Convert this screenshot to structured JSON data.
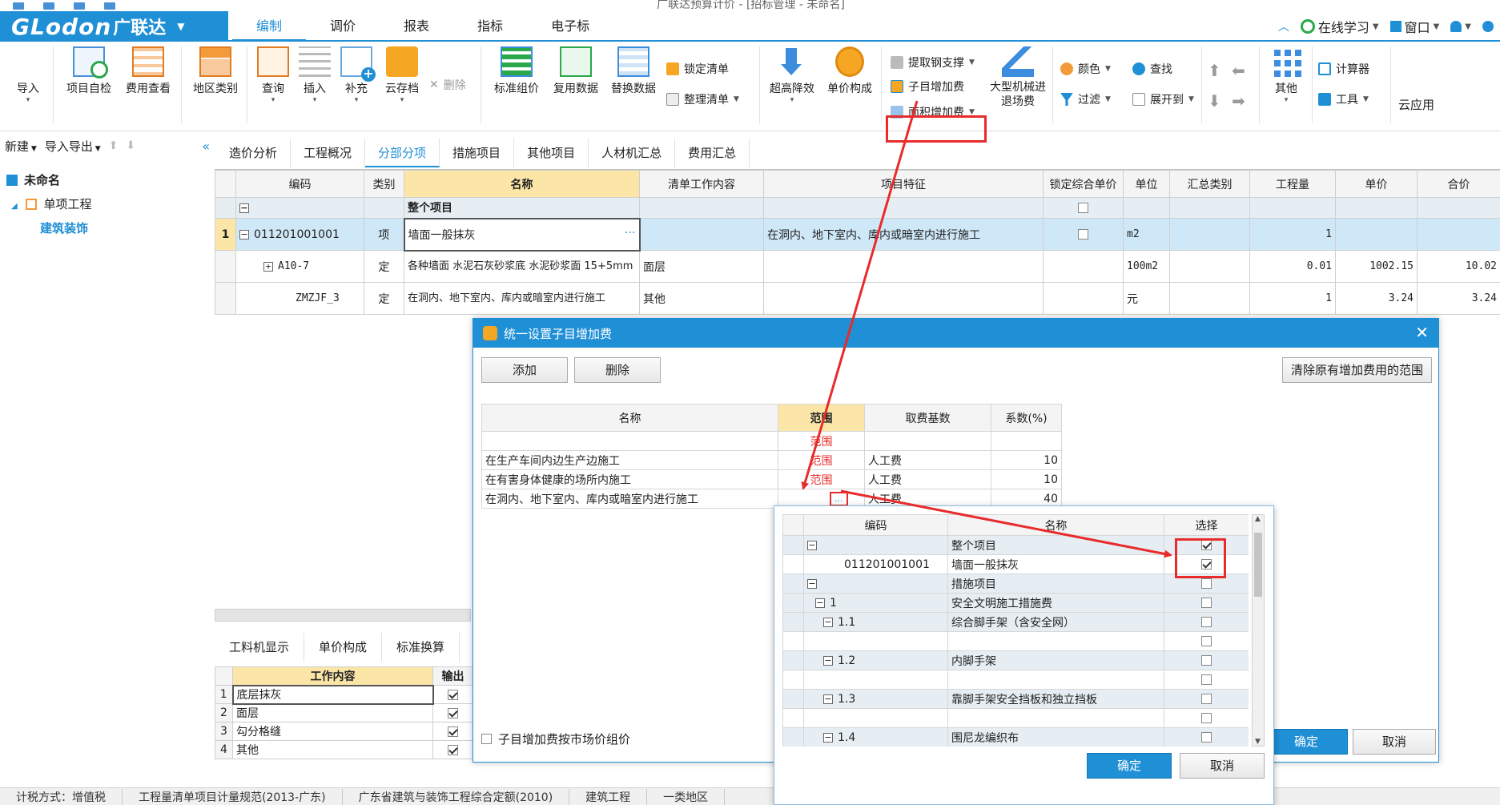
{
  "window": {
    "title": "广联达预算计价 - [招标管理 - 未命名]"
  },
  "brand": {
    "name": "GLodon",
    "cn": "广联达"
  },
  "menu": {
    "tabs": [
      "编制",
      "调价",
      "报表",
      "指标",
      "电子标"
    ],
    "active": 0,
    "online": "在线学习",
    "window": "窗口"
  },
  "ribbon": {
    "import": "导入",
    "self_check": "项目自检",
    "fee_view": "费用查看",
    "region": "地区类别",
    "query": "查询",
    "insert": "插入",
    "supplement": "补充",
    "cloud": "云存档",
    "delete": "删除",
    "std_price": "标准组价",
    "reuse": "复用数据",
    "replace": "替换数据",
    "lock_list": "锁定清单",
    "tidy_list": "整理清单",
    "reduce": "超高降效",
    "unit_comp": "单价构成",
    "steel": "提取钢支撑",
    "sub_add": "子目增加费",
    "area_add": "面积增加费",
    "machine": "大型机械进退场费",
    "color": "颜色",
    "filter": "过滤",
    "find": "查找",
    "expand": "展开到",
    "other": "其他",
    "calculator": "计算器",
    "tools": "工具",
    "cloud_app": "云应用"
  },
  "left": {
    "new": "新建",
    "import_export": "导入导出",
    "tree": [
      "未命名",
      "单项工程",
      "建筑装饰"
    ]
  },
  "subtabs": [
    "造价分析",
    "工程概况",
    "分部分项",
    "措施项目",
    "其他项目",
    "人材机汇总",
    "费用汇总"
  ],
  "subtab_active": 2,
  "grid": {
    "headers": [
      "编码",
      "类别",
      "名称",
      "清单工作内容",
      "项目特征",
      "锁定综合单价",
      "单位",
      "汇总类别",
      "工程量",
      "单价",
      "合价"
    ],
    "group_label": "整个项目",
    "rows": [
      {
        "rn": "1",
        "code": "011201001001",
        "type": "项",
        "name": "墙面一般抹灰",
        "content": "",
        "feature": "在洞内、地下室内、库内或暗室内进行施工",
        "unit": "m2",
        "qty": "1",
        "price": "",
        "total": ""
      },
      {
        "rn": "",
        "code": "A10-7",
        "type": "定",
        "name": "各种墙面 水泥石灰砂浆底 水泥砂浆面 15+5mm",
        "content": "面层",
        "feature": "",
        "unit": "100m2",
        "qty": "0.01",
        "price": "1002.15",
        "total": "10.02"
      },
      {
        "rn": "",
        "code": "ZMZJF_3",
        "type": "定",
        "name": "在洞内、地下室内、库内或暗室内进行施工",
        "content": "其他",
        "feature": "",
        "unit": "元",
        "qty": "1",
        "price": "3.24",
        "total": "3.24"
      }
    ]
  },
  "lower": {
    "tabs": [
      "工料机显示",
      "单价构成",
      "标准换算"
    ],
    "headers": [
      "工作内容",
      "输出"
    ],
    "rows": [
      {
        "rn": "1",
        "name": "底层抹灰"
      },
      {
        "rn": "2",
        "name": "面层"
      },
      {
        "rn": "3",
        "name": "勾分格缝"
      },
      {
        "rn": "4",
        "name": "其他"
      }
    ]
  },
  "status": [
    "计税方式：增值税",
    "工程量清单项目计量规范(2013-广东)",
    "广东省建筑与装饰工程综合定额(2010)",
    "建筑工程",
    "一类地区"
  ],
  "dialog": {
    "title": "统一设置子目增加费",
    "add": "添加",
    "delete": "删除",
    "clear": "清除原有增加费用的范围",
    "headers": [
      "名称",
      "范围",
      "取费基数",
      "系数(%)"
    ],
    "range_word": "范围",
    "rows": [
      {
        "name": "在生产车间内边生产边施工",
        "base": "人工费",
        "coef": "10"
      },
      {
        "name": "在有害身体健康的场所内施工",
        "base": "人工费",
        "coef": "10"
      },
      {
        "name": "在洞内、地下室内、库内或暗室内进行施工",
        "base": "人工费",
        "coef": "40"
      }
    ],
    "ellipsis": "...",
    "market_check": "子目增加费按市场价组价",
    "ok": "确定",
    "cancel": "取消"
  },
  "popup": {
    "headers": [
      "编码",
      "名称",
      "选择"
    ],
    "rows": [
      {
        "code": "",
        "name": "整个项目",
        "checked": true
      },
      {
        "code": "011201001001",
        "name": "墙面一般抹灰",
        "checked": true
      },
      {
        "code": "",
        "name": "措施项目",
        "checked": false
      },
      {
        "code": "1",
        "name": "安全文明施工措施费",
        "checked": false
      },
      {
        "code": "1.1",
        "name": "综合脚手架（含安全网）",
        "checked": false
      },
      {
        "code": "",
        "name": "",
        "checked": false
      },
      {
        "code": "1.2",
        "name": "内脚手架",
        "checked": false
      },
      {
        "code": "",
        "name": "",
        "checked": false
      },
      {
        "code": "1.3",
        "name": "靠脚手架安全挡板和独立挡板",
        "checked": false
      },
      {
        "code": "",
        "name": "",
        "checked": false
      },
      {
        "code": "1.4",
        "name": "围尼龙编织布",
        "checked": false
      }
    ],
    "ok": "确定",
    "cancel": "取消"
  },
  "colors": {
    "accent": "#1f8fd6",
    "highlight": "#e82b2b",
    "header_yellow": "#fbe6a8",
    "selected_row": "#cfe8f7"
  }
}
